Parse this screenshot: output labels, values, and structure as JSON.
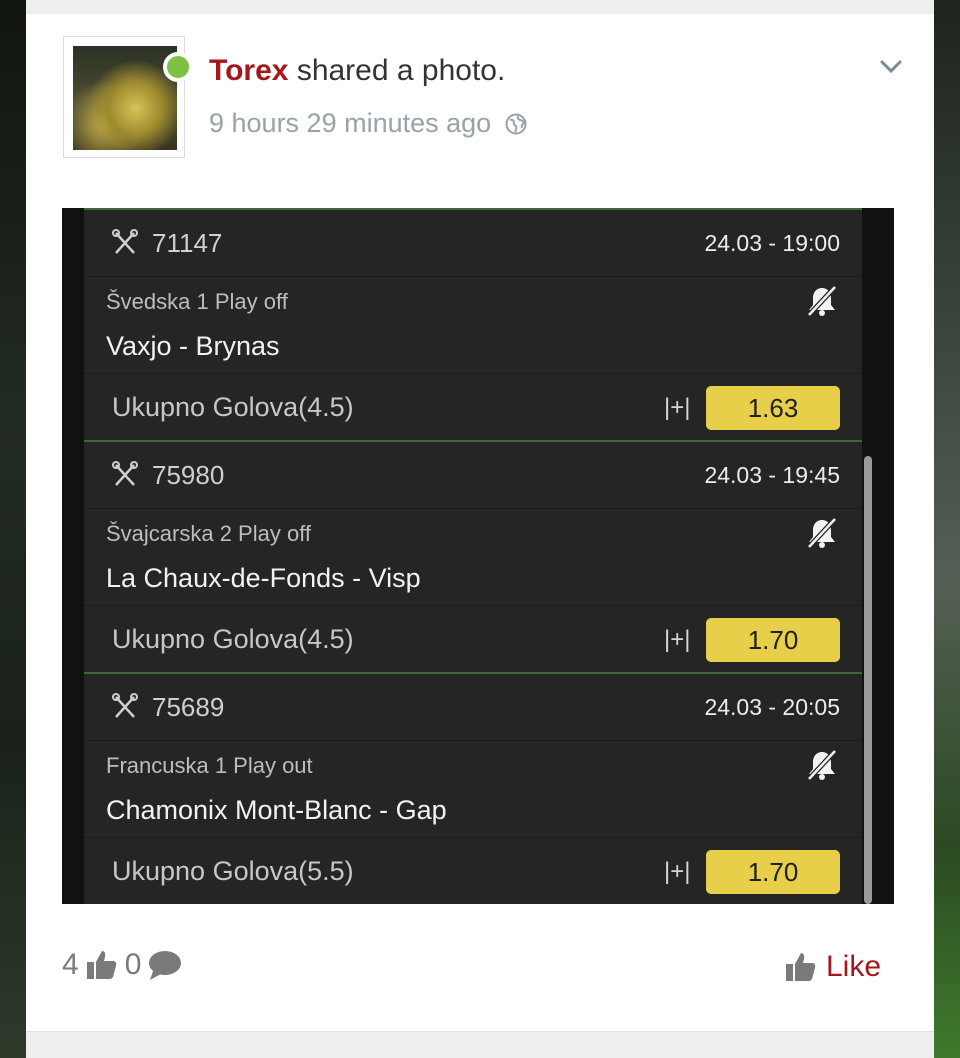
{
  "post": {
    "author": "Torex",
    "action": "shared a photo.",
    "time": "9 hours 29 minutes ago",
    "visibility_icon": "globe-icon",
    "menu_icon": "chevron-down-icon",
    "online": true
  },
  "bets": [
    {
      "id": "71147",
      "datetime": "24.03 - 19:00",
      "league": "Švedska 1 Play off",
      "teams": "Vaxjo - Brynas",
      "market": "Ukupno Golova(4.5)",
      "sign": "|+|",
      "odd": "1.63"
    },
    {
      "id": "75980",
      "datetime": "24.03 - 19:45",
      "league": "Švajcarska 2 Play off",
      "teams": "La Chaux-de-Fonds - Visp",
      "market": "Ukupno Golova(4.5)",
      "sign": "|+|",
      "odd": "1.70"
    },
    {
      "id": "75689",
      "datetime": "24.03 - 20:05",
      "league": "Francuska 1 Play out",
      "teams": "Chamonix Mont-Blanc - Gap",
      "market": "Ukupno Golova(5.5)",
      "sign": "|+|",
      "odd": "1.70"
    }
  ],
  "footer": {
    "likes": "4",
    "comments": "0",
    "like_label": "Like"
  },
  "colors": {
    "author": "#a3171d",
    "odd_bg": "#e8cf4a",
    "online": "#7cc142",
    "separator": "#3c6a34"
  }
}
